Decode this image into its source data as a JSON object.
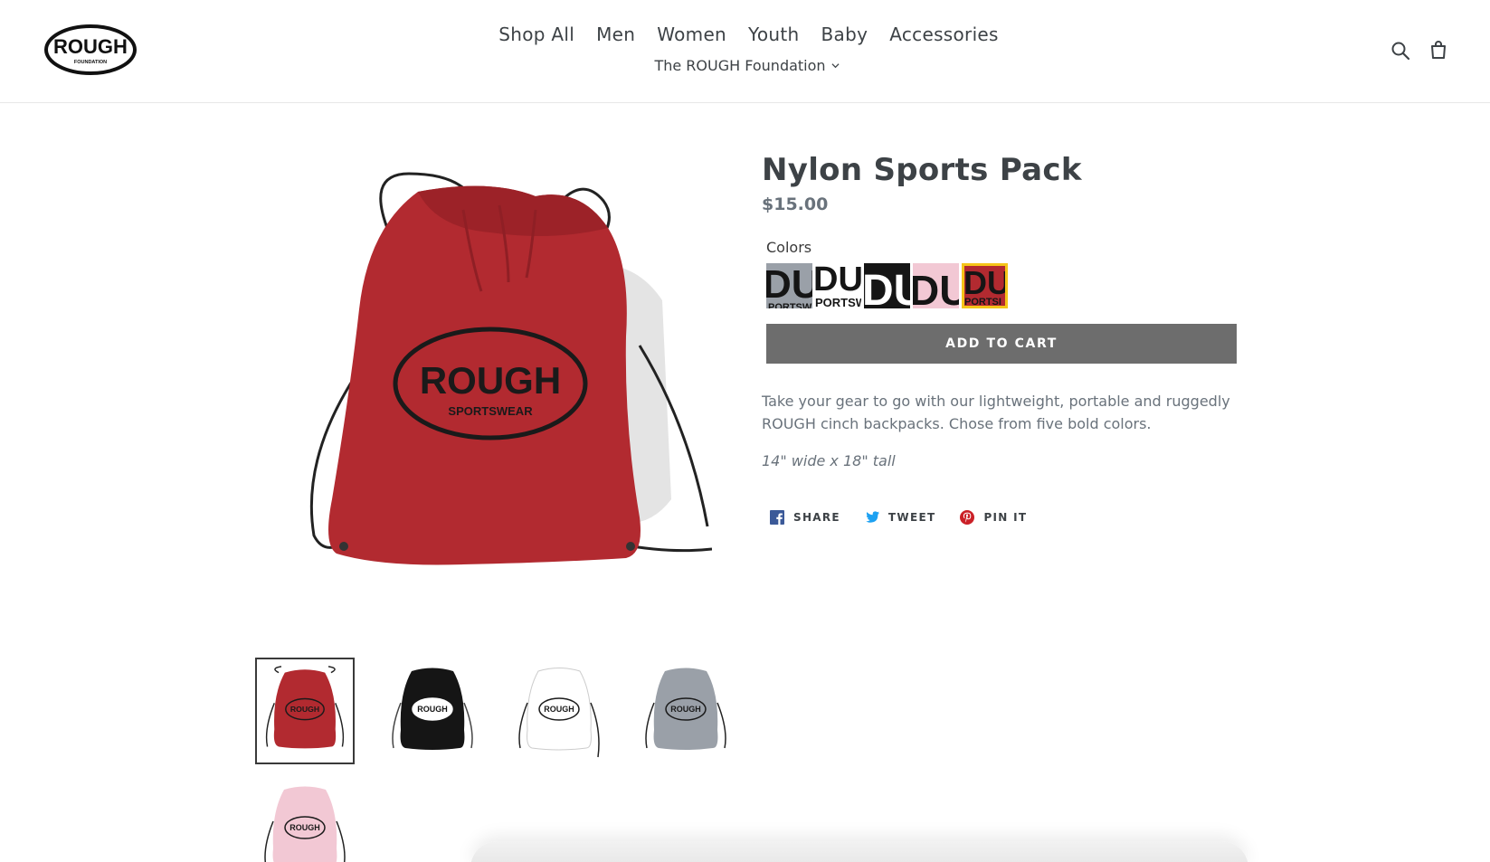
{
  "brand": {
    "logo_text": "ROUGH",
    "logo_subtext": "FOUNDATION"
  },
  "nav": {
    "items": [
      "Shop All",
      "Men",
      "Women",
      "Youth",
      "Baby",
      "Accessories"
    ],
    "sub_item": "The ROUGH Foundation"
  },
  "product": {
    "title": "Nylon Sports Pack",
    "price": "$15.00",
    "option_label": "Colors",
    "swatches": [
      {
        "color": "gray",
        "hex": "#9aa0a8"
      },
      {
        "color": "black",
        "hex": "#1a1a1a"
      },
      {
        "color": "white",
        "hex": "#ffffff"
      },
      {
        "color": "pink",
        "hex": "#f2c8d4"
      },
      {
        "color": "red",
        "hex": "#b22a30",
        "selected": true
      }
    ],
    "add_to_cart": "ADD TO CART",
    "description": "Take your gear to go with our lightweight, portable and ruggedly ROUGH cinch backpacks. Chose from five bold colors.",
    "dimensions": "14\" wide x 18\" tall",
    "bag_logo_text": "ROUGH",
    "bag_logo_subtext": "SPORTSWEAR"
  },
  "thumbnails": [
    {
      "color": "red",
      "hex": "#b22a30",
      "active": true
    },
    {
      "color": "black",
      "hex": "#151515",
      "active": false
    },
    {
      "color": "white",
      "hex": "#ffffff",
      "active": false
    },
    {
      "color": "gray",
      "hex": "#9aa0a8",
      "active": false
    },
    {
      "color": "pink",
      "hex": "#f2c8d4",
      "active": false
    }
  ],
  "share": {
    "facebook": "SHARE",
    "twitter": "TWEET",
    "pinterest": "PIN IT"
  },
  "colors": {
    "text": "#3d4246",
    "muted": "#69727b",
    "button": "#6d6d6d",
    "selected_outline": "#f5c518",
    "facebook": "#3b5998",
    "twitter": "#1da1f2",
    "pinterest": "#cb2027"
  },
  "icons": [
    "search-icon",
    "cart-icon",
    "chevron-down-icon",
    "facebook-icon",
    "twitter-icon",
    "pinterest-icon"
  ]
}
